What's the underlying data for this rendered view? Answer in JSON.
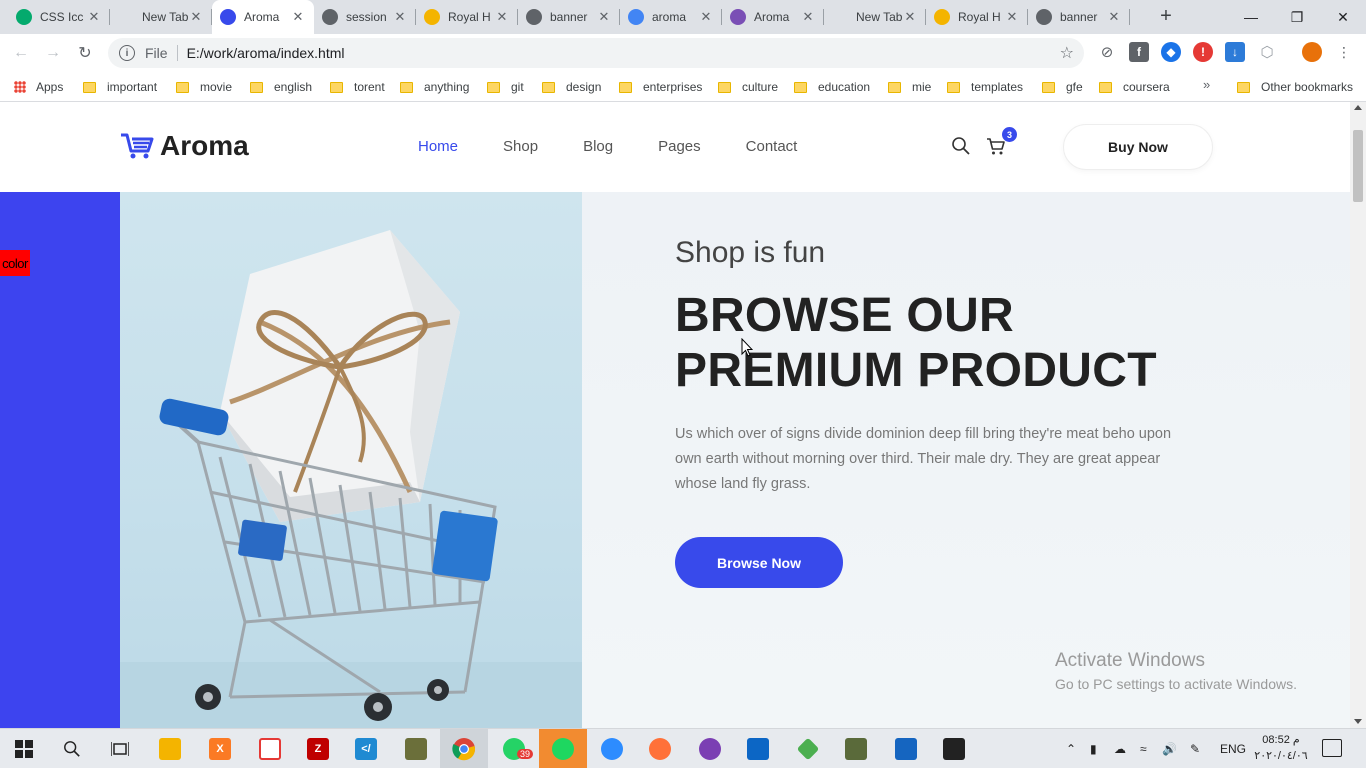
{
  "browser": {
    "tabs": [
      {
        "title": "CSS Icc",
        "favicon": "w3schools-icon",
        "color": "#04aa6d",
        "active": false
      },
      {
        "title": "New Tab",
        "favicon": "none",
        "color": "#dee1e6",
        "active": false
      },
      {
        "title": "Aroma",
        "favicon": "cart-icon",
        "color": "#384aeb",
        "active": true
      },
      {
        "title": "session",
        "favicon": "globe-icon",
        "color": "#5f6368",
        "active": false
      },
      {
        "title": "Royal H",
        "favicon": "crown-icon",
        "color": "#f4b400",
        "active": false
      },
      {
        "title": "banner",
        "favicon": "globe-icon",
        "color": "#5f6368",
        "active": false
      },
      {
        "title": "aroma",
        "favicon": "google-icon",
        "color": "#4285f4",
        "active": false
      },
      {
        "title": "Aroma",
        "favicon": "theme-icon",
        "color": "#7a4fb5",
        "active": false
      },
      {
        "title": "New Tab",
        "favicon": "none",
        "color": "#dee1e6",
        "active": false
      },
      {
        "title": "Royal H",
        "favicon": "crown-icon",
        "color": "#f4b400",
        "active": false
      },
      {
        "title": "banner",
        "favicon": "globe-icon",
        "color": "#5f6368",
        "active": false
      }
    ],
    "omnibox": {
      "scheme_label": "File",
      "url": "E:/work/aroma/index.html"
    },
    "bookmarks": [
      {
        "label": "Apps",
        "type": "apps"
      },
      {
        "label": "important",
        "type": "folder"
      },
      {
        "label": "movie",
        "type": "folder"
      },
      {
        "label": "english",
        "type": "folder"
      },
      {
        "label": "torent",
        "type": "folder"
      },
      {
        "label": "anything",
        "type": "folder"
      },
      {
        "label": "git",
        "type": "folder"
      },
      {
        "label": "design",
        "type": "folder"
      },
      {
        "label": "enterprises",
        "type": "folder"
      },
      {
        "label": "culture",
        "type": "folder"
      },
      {
        "label": "education",
        "type": "folder"
      },
      {
        "label": "mie",
        "type": "folder"
      },
      {
        "label": "templates",
        "type": "folder"
      },
      {
        "label": "gfe",
        "type": "folder"
      },
      {
        "label": "coursera",
        "type": "folder"
      }
    ],
    "bookmarks_more": "»",
    "other_bookmarks": "Other bookmarks"
  },
  "site": {
    "brand": "Aroma",
    "nav": [
      {
        "label": "Home",
        "active": true
      },
      {
        "label": "Shop",
        "active": false
      },
      {
        "label": "Blog",
        "active": false
      },
      {
        "label": "Pages",
        "active": false
      },
      {
        "label": "Contact",
        "active": false
      }
    ],
    "cart_count": "3",
    "buy_now": "Buy Now",
    "accent_color": "#384aeb"
  },
  "hero": {
    "color_tag": "color",
    "kicker": "Shop is fun",
    "title_line1": "BROWSE OUR",
    "title_line2": "PREMIUM PRODUCT",
    "text": "Us which over of signs divide dominion deep fill bring they're meat beho upon own earth without morning over third. Their male dry. They are great appear whose land fly grass.",
    "cta": "Browse Now"
  },
  "windows_watermark": {
    "title": "Activate Windows",
    "subtitle": "Go to PC settings to activate Windows."
  },
  "taskbar": {
    "whatsapp_badge": "39",
    "language": "ENG",
    "time": "08:52 م",
    "date": "٢٠٢٠/٠٤/٠٦"
  }
}
